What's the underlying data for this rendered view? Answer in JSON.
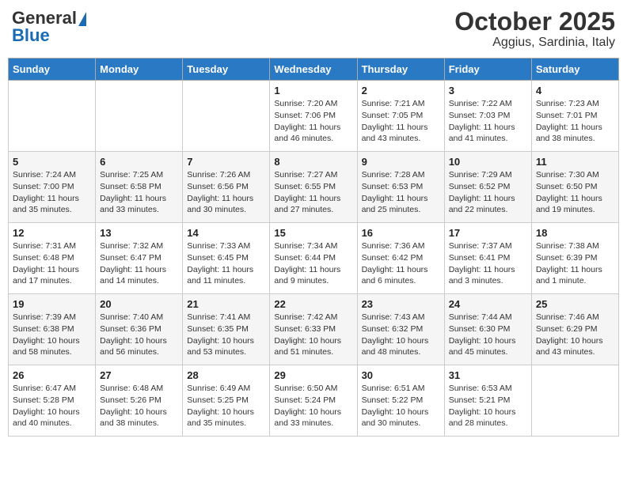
{
  "header": {
    "logo_general": "General",
    "logo_blue": "Blue",
    "month": "October 2025",
    "location": "Aggius, Sardinia, Italy"
  },
  "days_of_week": [
    "Sunday",
    "Monday",
    "Tuesday",
    "Wednesday",
    "Thursday",
    "Friday",
    "Saturday"
  ],
  "weeks": [
    [
      {
        "day": "",
        "info": ""
      },
      {
        "day": "",
        "info": ""
      },
      {
        "day": "",
        "info": ""
      },
      {
        "day": "1",
        "info": "Sunrise: 7:20 AM\nSunset: 7:06 PM\nDaylight: 11 hours and 46 minutes."
      },
      {
        "day": "2",
        "info": "Sunrise: 7:21 AM\nSunset: 7:05 PM\nDaylight: 11 hours and 43 minutes."
      },
      {
        "day": "3",
        "info": "Sunrise: 7:22 AM\nSunset: 7:03 PM\nDaylight: 11 hours and 41 minutes."
      },
      {
        "day": "4",
        "info": "Sunrise: 7:23 AM\nSunset: 7:01 PM\nDaylight: 11 hours and 38 minutes."
      }
    ],
    [
      {
        "day": "5",
        "info": "Sunrise: 7:24 AM\nSunset: 7:00 PM\nDaylight: 11 hours and 35 minutes."
      },
      {
        "day": "6",
        "info": "Sunrise: 7:25 AM\nSunset: 6:58 PM\nDaylight: 11 hours and 33 minutes."
      },
      {
        "day": "7",
        "info": "Sunrise: 7:26 AM\nSunset: 6:56 PM\nDaylight: 11 hours and 30 minutes."
      },
      {
        "day": "8",
        "info": "Sunrise: 7:27 AM\nSunset: 6:55 PM\nDaylight: 11 hours and 27 minutes."
      },
      {
        "day": "9",
        "info": "Sunrise: 7:28 AM\nSunset: 6:53 PM\nDaylight: 11 hours and 25 minutes."
      },
      {
        "day": "10",
        "info": "Sunrise: 7:29 AM\nSunset: 6:52 PM\nDaylight: 11 hours and 22 minutes."
      },
      {
        "day": "11",
        "info": "Sunrise: 7:30 AM\nSunset: 6:50 PM\nDaylight: 11 hours and 19 minutes."
      }
    ],
    [
      {
        "day": "12",
        "info": "Sunrise: 7:31 AM\nSunset: 6:48 PM\nDaylight: 11 hours and 17 minutes."
      },
      {
        "day": "13",
        "info": "Sunrise: 7:32 AM\nSunset: 6:47 PM\nDaylight: 11 hours and 14 minutes."
      },
      {
        "day": "14",
        "info": "Sunrise: 7:33 AM\nSunset: 6:45 PM\nDaylight: 11 hours and 11 minutes."
      },
      {
        "day": "15",
        "info": "Sunrise: 7:34 AM\nSunset: 6:44 PM\nDaylight: 11 hours and 9 minutes."
      },
      {
        "day": "16",
        "info": "Sunrise: 7:36 AM\nSunset: 6:42 PM\nDaylight: 11 hours and 6 minutes."
      },
      {
        "day": "17",
        "info": "Sunrise: 7:37 AM\nSunset: 6:41 PM\nDaylight: 11 hours and 3 minutes."
      },
      {
        "day": "18",
        "info": "Sunrise: 7:38 AM\nSunset: 6:39 PM\nDaylight: 11 hours and 1 minute."
      }
    ],
    [
      {
        "day": "19",
        "info": "Sunrise: 7:39 AM\nSunset: 6:38 PM\nDaylight: 10 hours and 58 minutes."
      },
      {
        "day": "20",
        "info": "Sunrise: 7:40 AM\nSunset: 6:36 PM\nDaylight: 10 hours and 56 minutes."
      },
      {
        "day": "21",
        "info": "Sunrise: 7:41 AM\nSunset: 6:35 PM\nDaylight: 10 hours and 53 minutes."
      },
      {
        "day": "22",
        "info": "Sunrise: 7:42 AM\nSunset: 6:33 PM\nDaylight: 10 hours and 51 minutes."
      },
      {
        "day": "23",
        "info": "Sunrise: 7:43 AM\nSunset: 6:32 PM\nDaylight: 10 hours and 48 minutes."
      },
      {
        "day": "24",
        "info": "Sunrise: 7:44 AM\nSunset: 6:30 PM\nDaylight: 10 hours and 45 minutes."
      },
      {
        "day": "25",
        "info": "Sunrise: 7:46 AM\nSunset: 6:29 PM\nDaylight: 10 hours and 43 minutes."
      }
    ],
    [
      {
        "day": "26",
        "info": "Sunrise: 6:47 AM\nSunset: 5:28 PM\nDaylight: 10 hours and 40 minutes."
      },
      {
        "day": "27",
        "info": "Sunrise: 6:48 AM\nSunset: 5:26 PM\nDaylight: 10 hours and 38 minutes."
      },
      {
        "day": "28",
        "info": "Sunrise: 6:49 AM\nSunset: 5:25 PM\nDaylight: 10 hours and 35 minutes."
      },
      {
        "day": "29",
        "info": "Sunrise: 6:50 AM\nSunset: 5:24 PM\nDaylight: 10 hours and 33 minutes."
      },
      {
        "day": "30",
        "info": "Sunrise: 6:51 AM\nSunset: 5:22 PM\nDaylight: 10 hours and 30 minutes."
      },
      {
        "day": "31",
        "info": "Sunrise: 6:53 AM\nSunset: 5:21 PM\nDaylight: 10 hours and 28 minutes."
      },
      {
        "day": "",
        "info": ""
      }
    ]
  ]
}
